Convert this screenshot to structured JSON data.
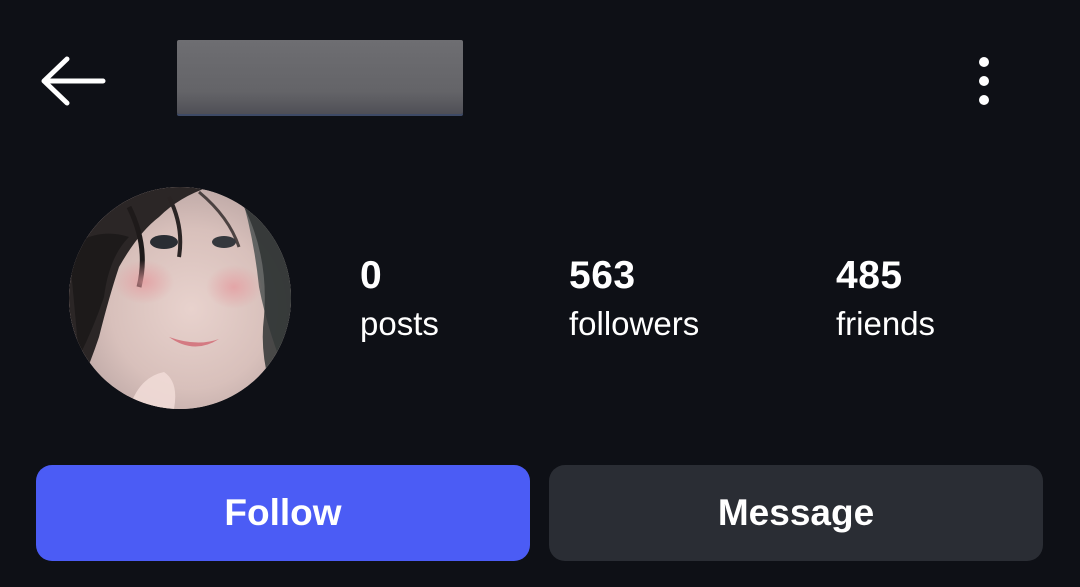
{
  "header": {
    "back_icon": "arrow-left-icon",
    "username": "",
    "more_icon": "more-vertical-icon"
  },
  "profile": {
    "avatar_alt": "profile photo"
  },
  "stats": {
    "posts": {
      "count": "0",
      "label": "posts"
    },
    "followers": {
      "count": "563",
      "label": "followers"
    },
    "friends": {
      "count": "485",
      "label": "friends"
    }
  },
  "actions": {
    "follow_label": "Follow",
    "message_label": "Message"
  },
  "colors": {
    "background": "#0e1016",
    "follow_button": "#4b5cf5",
    "message_button": "#2a2d34",
    "text": "#ffffff"
  }
}
